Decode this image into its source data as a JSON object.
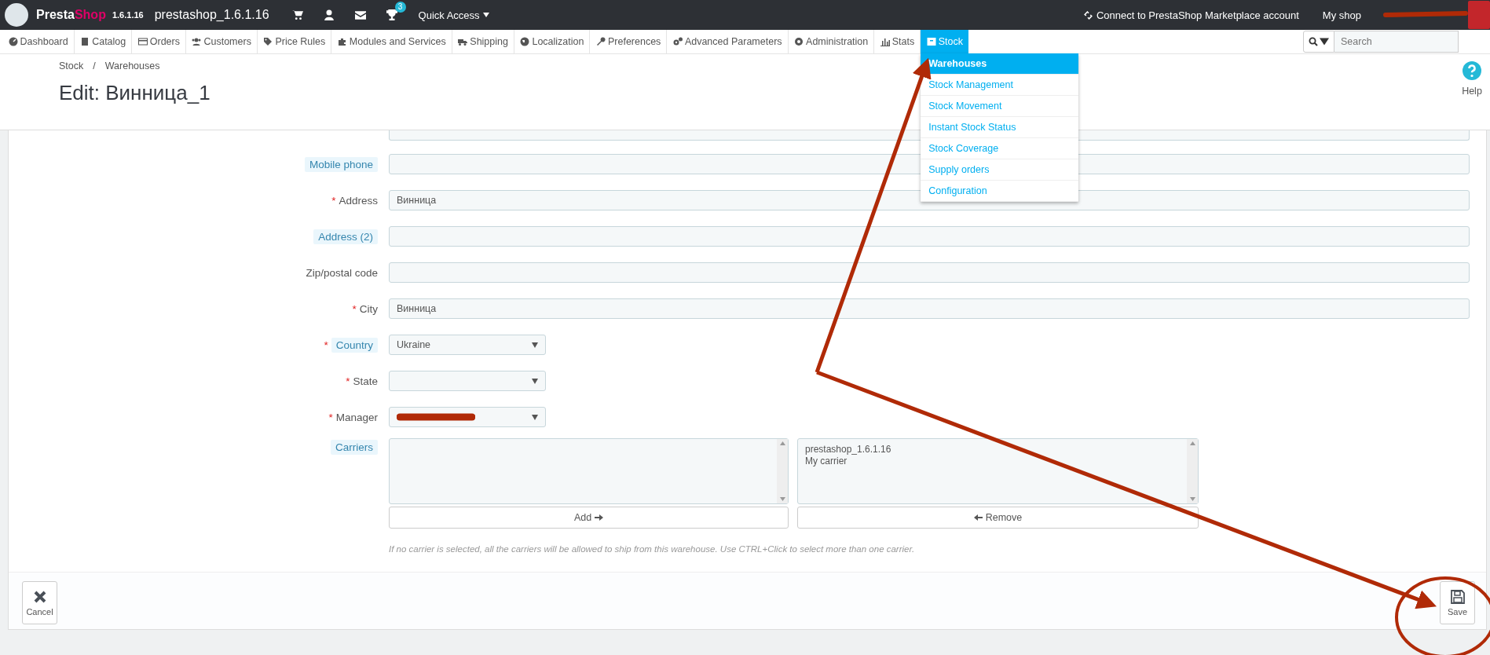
{
  "top_bar": {
    "brand": [
      "Presta",
      "Shop"
    ],
    "version": "1.6.1.16",
    "shop_name": "prestashop_1.6.1.16",
    "notification_badge": "3",
    "quick_access": "Quick Access",
    "marketplace_link": "Connect to PrestaShop Marketplace account",
    "my_shop": "My shop"
  },
  "nav": [
    {
      "label": "Dashboard",
      "selected": false
    },
    {
      "label": "Catalog",
      "selected": false
    },
    {
      "label": "Orders",
      "selected": false
    },
    {
      "label": "Customers",
      "selected": false
    },
    {
      "label": "Price Rules",
      "selected": false
    },
    {
      "label": "Modules and Services",
      "selected": false
    },
    {
      "label": "Shipping",
      "selected": false
    },
    {
      "label": "Localization",
      "selected": false
    },
    {
      "label": "Preferences",
      "selected": false
    },
    {
      "label": "Advanced Parameters",
      "selected": false
    },
    {
      "label": "Administration",
      "selected": false
    },
    {
      "label": "Stats",
      "selected": false
    },
    {
      "label": "Stock",
      "selected": true,
      "menu": [
        {
          "label": "Warehouses",
          "selected": true
        },
        {
          "label": "Stock Management",
          "selected": false
        },
        {
          "label": "Stock Movement",
          "selected": false
        },
        {
          "label": "Instant Stock Status",
          "selected": false
        },
        {
          "label": "Stock Coverage",
          "selected": false
        },
        {
          "label": "Supply orders",
          "selected": false
        },
        {
          "label": "Configuration",
          "selected": false
        }
      ]
    }
  ],
  "search": {
    "placeholder": "Search"
  },
  "breadcrumb": [
    "Stock",
    "/",
    "Warehouses"
  ],
  "page_title": "Edit: Винница_1",
  "help": "Help",
  "fields": [
    {
      "label": "Mobile phone",
      "kind": "text",
      "hint": true
    },
    {
      "label": "Address",
      "kind": "text",
      "hint": false,
      "marker": "*",
      "value": "Винница"
    },
    {
      "label": "Address (2)",
      "kind": "text",
      "hint": true
    },
    {
      "label": "Zip/postal code",
      "kind": "text",
      "hint": false
    },
    {
      "label": "City",
      "kind": "text",
      "hint": false,
      "marker": "*",
      "value": "Винница"
    },
    {
      "label": "Country",
      "kind": "select",
      "hint": true,
      "marker": "*",
      "value": "Ukraine"
    },
    {
      "label": "State",
      "kind": "select",
      "hint": false,
      "marker": "*"
    },
    {
      "label": "Manager",
      "kind": "select",
      "hint": false,
      "marker": "*",
      "redacted": true
    }
  ],
  "carriers": {
    "label": "Carriers",
    "selected": [
      "prestashop_1.6.1.16",
      "My carrier"
    ],
    "add_button": "Add",
    "remove_button": "Remove",
    "help": "If no carrier is selected, all the carriers will be allowed to ship from this warehouse. Use CTRL+Click to select more than one carrier."
  },
  "footer": {
    "cancel": "Cancel",
    "save": "Save"
  }
}
